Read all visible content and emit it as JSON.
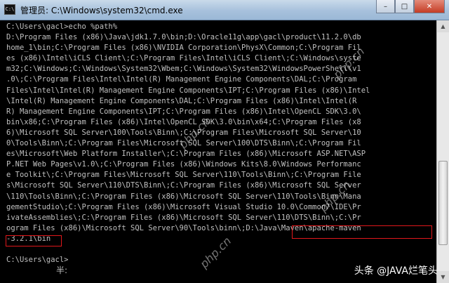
{
  "window": {
    "title": "管理员: C:\\Windows\\system32\\cmd.exe",
    "icon_glyph": "C:\\",
    "controls": {
      "minimize": "–",
      "maximize": "□",
      "close": "✕"
    }
  },
  "console": {
    "lines": [
      "C:\\Users\\gacl>echo %path%",
      "D:\\Program Files (x86)\\Java\\jdk1.7.0\\bin;D:\\Oracle11g\\app\\gacl\\product\\11.2.0\\db",
      "home_1\\bin;C:\\Program Files (x86)\\NVIDIA Corporation\\PhysX\\Common;C:\\Program Fil",
      "es (x86)\\Intel\\iCLS Client\\;C:\\Program Files\\Intel\\iCLS Client\\;C:\\Windows\\syste",
      "m32;C:\\Windows;C:\\Windows\\System32\\Wbem;C:\\Windows\\System32\\WindowsPowerShell\\v1",
      ".0\\;C:\\Program Files\\Intel\\Intel(R) Management Engine Components\\DAL;C:\\Program",
      "Files\\Intel\\Intel(R) Management Engine Components\\IPT;C:\\Program Files (x86)\\Intel",
      "\\Intel(R) Management Engine Components\\DAL;C:\\Program Files (x86)\\Intel\\Intel(R",
      "R) Management Engine Components\\IPT;C:\\Program Files (x86)\\Intel\\OpenCL SDK\\3.0\\",
      "bin\\x86;C:\\Program Files (x86)\\Intel\\OpenCL SDK\\3.0\\bin\\x64;C:\\Program Files (x8",
      "6)\\Microsoft SQL Server\\100\\Tools\\Binn\\;C:\\Program Files\\Microsoft SQL Server\\10",
      "0\\Tools\\Binn\\;C:\\Program Files\\Microsoft SQL Server\\100\\DTS\\Binn\\;C:\\Program Fil",
      "es\\Microsoft\\Web Platform Installer\\;C:\\Program Files (x86)\\Microsoft ASP.NET\\ASP",
      "P.NET Web Pages\\v1.0\\;C:\\Program Files (x86)\\Windows Kits\\8.0\\Windows Performanc",
      "e Toolkit\\;C:\\Program Files\\Microsoft SQL Server\\110\\Tools\\Binn\\;C:\\Program File",
      "s\\Microsoft SQL Server\\110\\DTS\\Binn\\;C:\\Program Files (x86)\\Microsoft SQL Server",
      "\\110\\Tools\\Binn\\;C:\\Program Files (x86)\\Microsoft SQL Server\\110\\Tools\\Binn\\Mana",
      "gementStudio\\;C:\\Program Files (x86)\\Microsoft Visual Studio 10.0\\Common7\\IDE\\Pr",
      "ivateAssemblies\\;C:\\Program Files (x86)\\Microsoft SQL Server\\110\\DTS\\Binn\\;C:\\Pr",
      "ogram Files (x86)\\Microsoft SQL Server\\90\\Tools\\binn\\;D:\\Java\\Maven\\apache-maven",
      "-3.2.1\\bin",
      "",
      "C:\\Users\\gacl>"
    ]
  },
  "ime_indicator": "半:",
  "watermark": "php.cn",
  "credit": "头条 @JAVA烂笔头"
}
